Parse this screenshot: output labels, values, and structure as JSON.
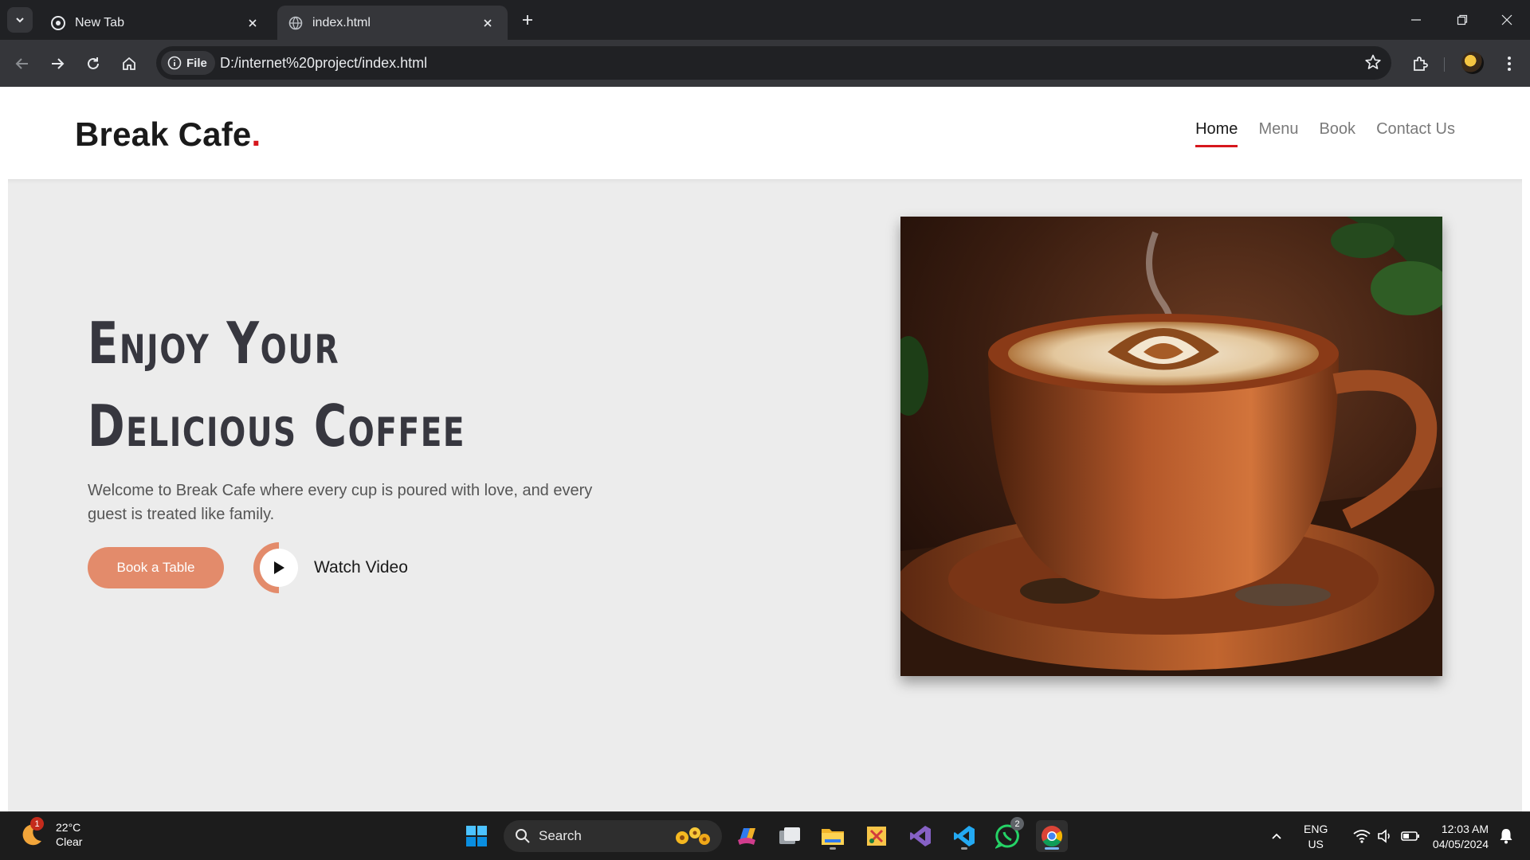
{
  "browser": {
    "tabs": [
      {
        "title": "New Tab",
        "active": false
      },
      {
        "title": "index.html",
        "active": true
      }
    ],
    "omnibox": {
      "chip_label": "File",
      "url": "D:/internet%20project/index.html"
    }
  },
  "site": {
    "logo": {
      "text": "Break Cafe",
      "dot": "."
    },
    "nav": [
      {
        "label": "Home",
        "active": true
      },
      {
        "label": "Menu",
        "active": false
      },
      {
        "label": "Book",
        "active": false
      },
      {
        "label": "Contact Us",
        "active": false
      }
    ],
    "hero": {
      "title_line1": "Enjoy Your",
      "title_line2": "Delicious Coffee",
      "text": "Welcome to Break Cafe where every cup is poured with love, and every guest is treated like family.",
      "book_button": "Book a Table",
      "watch_label": "Watch Video",
      "image_alt": "latte-art-coffee-cup"
    },
    "colors": {
      "accent": "#e38b6b",
      "logo_dot": "#d6171d"
    }
  },
  "taskbar": {
    "weather": {
      "temp": "22°C",
      "condition": "Clear",
      "badge": "1"
    },
    "search_label": "Search",
    "whatsapp_badge": "2",
    "language": {
      "line1": "ENG",
      "line2": "US"
    },
    "clock": {
      "time": "12:03 AM",
      "date": "04/05/2024"
    }
  }
}
